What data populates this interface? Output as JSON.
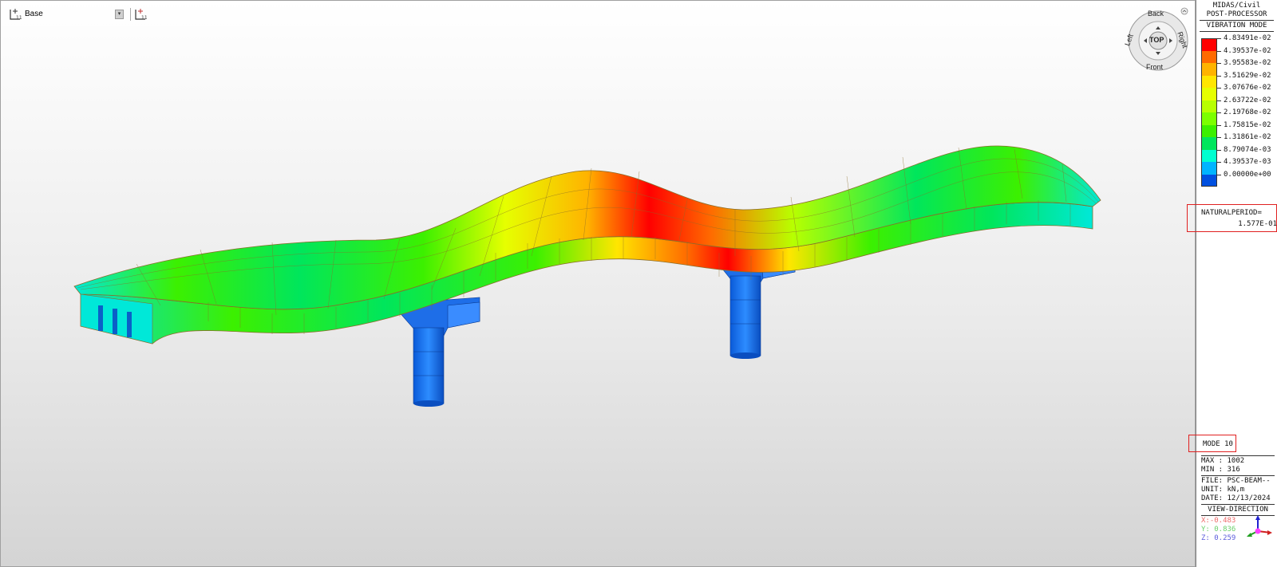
{
  "toolbar": {
    "base_label": "Base",
    "icons": [
      "grid-ucs-icon",
      "dropdown-arrow-icon",
      "grid-ucs-icon"
    ]
  },
  "viewcube": {
    "top": "TOP",
    "back": "Back",
    "front": "Front",
    "left": "Left",
    "right": "Right"
  },
  "panel": {
    "app": "MIDAS/Civil",
    "module": "POST-PROCESSOR",
    "result": "VIBRATION MODE",
    "legend": [
      {
        "value": "4.83491e-02",
        "color": "#ff0000"
      },
      {
        "value": "4.39537e-02",
        "color": "#ff6a00"
      },
      {
        "value": "3.95583e-02",
        "color": "#ffb300"
      },
      {
        "value": "3.51629e-02",
        "color": "#ffe600"
      },
      {
        "value": "3.07676e-02",
        "color": "#e6ff00"
      },
      {
        "value": "2.63722e-02",
        "color": "#b8ff00"
      },
      {
        "value": "2.19768e-02",
        "color": "#7cff00"
      },
      {
        "value": "1.75815e-02",
        "color": "#3cf000"
      },
      {
        "value": "1.31861e-02",
        "color": "#00e65c"
      },
      {
        "value": "8.79074e-03",
        "color": "#00ffd0"
      },
      {
        "value": "4.39537e-03",
        "color": "#00b4ff"
      },
      {
        "value": "0.00000e+00",
        "color": "#0050e0"
      }
    ],
    "natural_period_label": "NATURALPERIOD=",
    "natural_period_value": "1.577E-01",
    "mode": "MODE 10",
    "max": "MAX : 1002",
    "min": "MIN : 316",
    "file": "FILE: PSC-BEAM--",
    "unit": "UNIT: kN,m",
    "date": "DATE: 12/13/2024",
    "view_direction": "VIEW-DIRECTION",
    "vd_x": "X:-0.483",
    "vd_y": "Y: 0.836",
    "vd_z": "Z: 0.259"
  }
}
